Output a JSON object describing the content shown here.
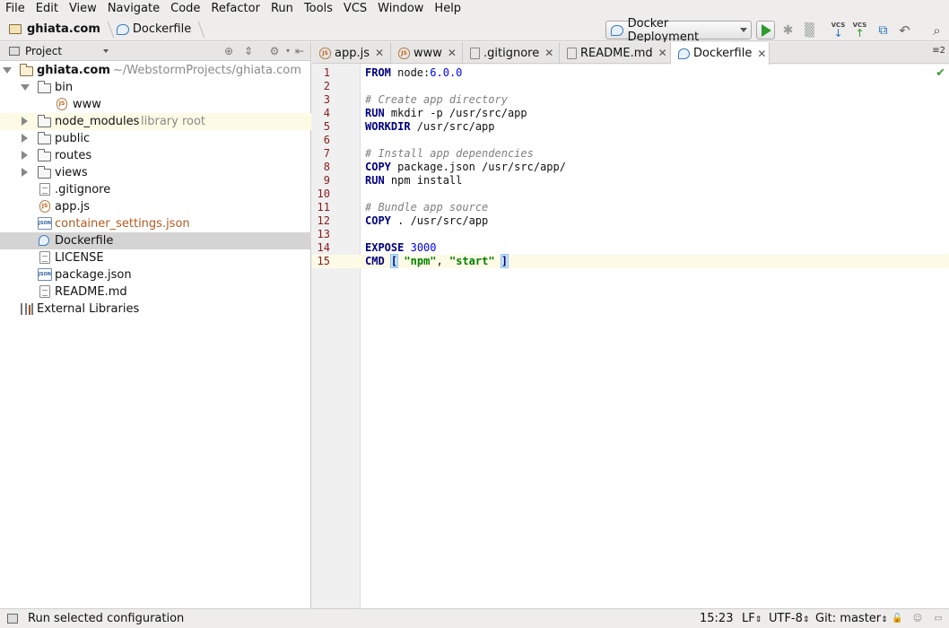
{
  "menu": [
    "File",
    "Edit",
    "View",
    "Navigate",
    "Code",
    "Refactor",
    "Run",
    "Tools",
    "VCS",
    "Window",
    "Help"
  ],
  "breadcrumb": {
    "project": "ghiata.com",
    "file": "Dockerfile"
  },
  "run_config": {
    "label": "Docker Deployment"
  },
  "toolbar": {
    "vcs_update": "VCS",
    "vcs_commit": "VCS"
  },
  "project_panel": {
    "title": "Project",
    "tree": {
      "root": {
        "name": "ghiata.com",
        "path": "~/WebstormProjects/ghiata.com"
      },
      "bin": "bin",
      "www": "www",
      "node_modules": "node_modules",
      "node_modules_note": "library root",
      "public": "public",
      "routes": "routes",
      "views": "views",
      "gitignore": ".gitignore",
      "appjs": "app.js",
      "container_settings": "container_settings.json",
      "dockerfile": "Dockerfile",
      "license": "LICENSE",
      "package_json": "package.json",
      "readme": "README.md",
      "external_libraries": "External Libraries"
    },
    "icons": {
      "js_badge": "JS",
      "json_badge": "JSON"
    }
  },
  "tabs": [
    {
      "label": "app.js"
    },
    {
      "label": "www"
    },
    {
      "label": ".gitignore"
    },
    {
      "label": "README.md"
    },
    {
      "label": "Dockerfile"
    }
  ],
  "tab_overflow": "≡2",
  "editor": {
    "line_numbers": [
      "1",
      "2",
      "3",
      "4",
      "5",
      "6",
      "7",
      "8",
      "9",
      "10",
      "11",
      "12",
      "13",
      "14",
      "15"
    ],
    "lines": {
      "l1": {
        "kw": "FROM",
        "rest": " node:",
        "num": "6.0.0"
      },
      "l3": {
        "cmt": "# Create app directory"
      },
      "l4": {
        "kw": "RUN",
        "rest": " mkdir -p /usr/src/app"
      },
      "l5": {
        "kw": "WORKDIR",
        "rest": " /usr/src/app"
      },
      "l7": {
        "cmt": "# Install app dependencies"
      },
      "l8": {
        "kw": "COPY",
        "rest": " package.json /usr/src/app/"
      },
      "l9": {
        "kw": "RUN",
        "rest": " npm install"
      },
      "l11": {
        "cmt": "# Bundle app source"
      },
      "l12": {
        "kw": "COPY",
        "rest": " . /usr/src/app"
      },
      "l14": {
        "kw": "EXPOSE",
        "num": "3000"
      },
      "l15": {
        "kw": "CMD",
        "open": "[",
        "s1": "\"npm\"",
        "comma": ", ",
        "s2": "\"start\"",
        "close": "]"
      }
    },
    "caret_line": 15
  },
  "status": {
    "message": "Run selected configuration",
    "position": "15:23",
    "line_sep": "LF",
    "encoding": "UTF-8",
    "git": "Git: master"
  },
  "colors": {
    "keyword": "#000080",
    "number": "#0000ff",
    "comment": "#808080",
    "string": "#008000",
    "caret_line": "#fdfbe6",
    "run_green": "#2e9b2e"
  }
}
